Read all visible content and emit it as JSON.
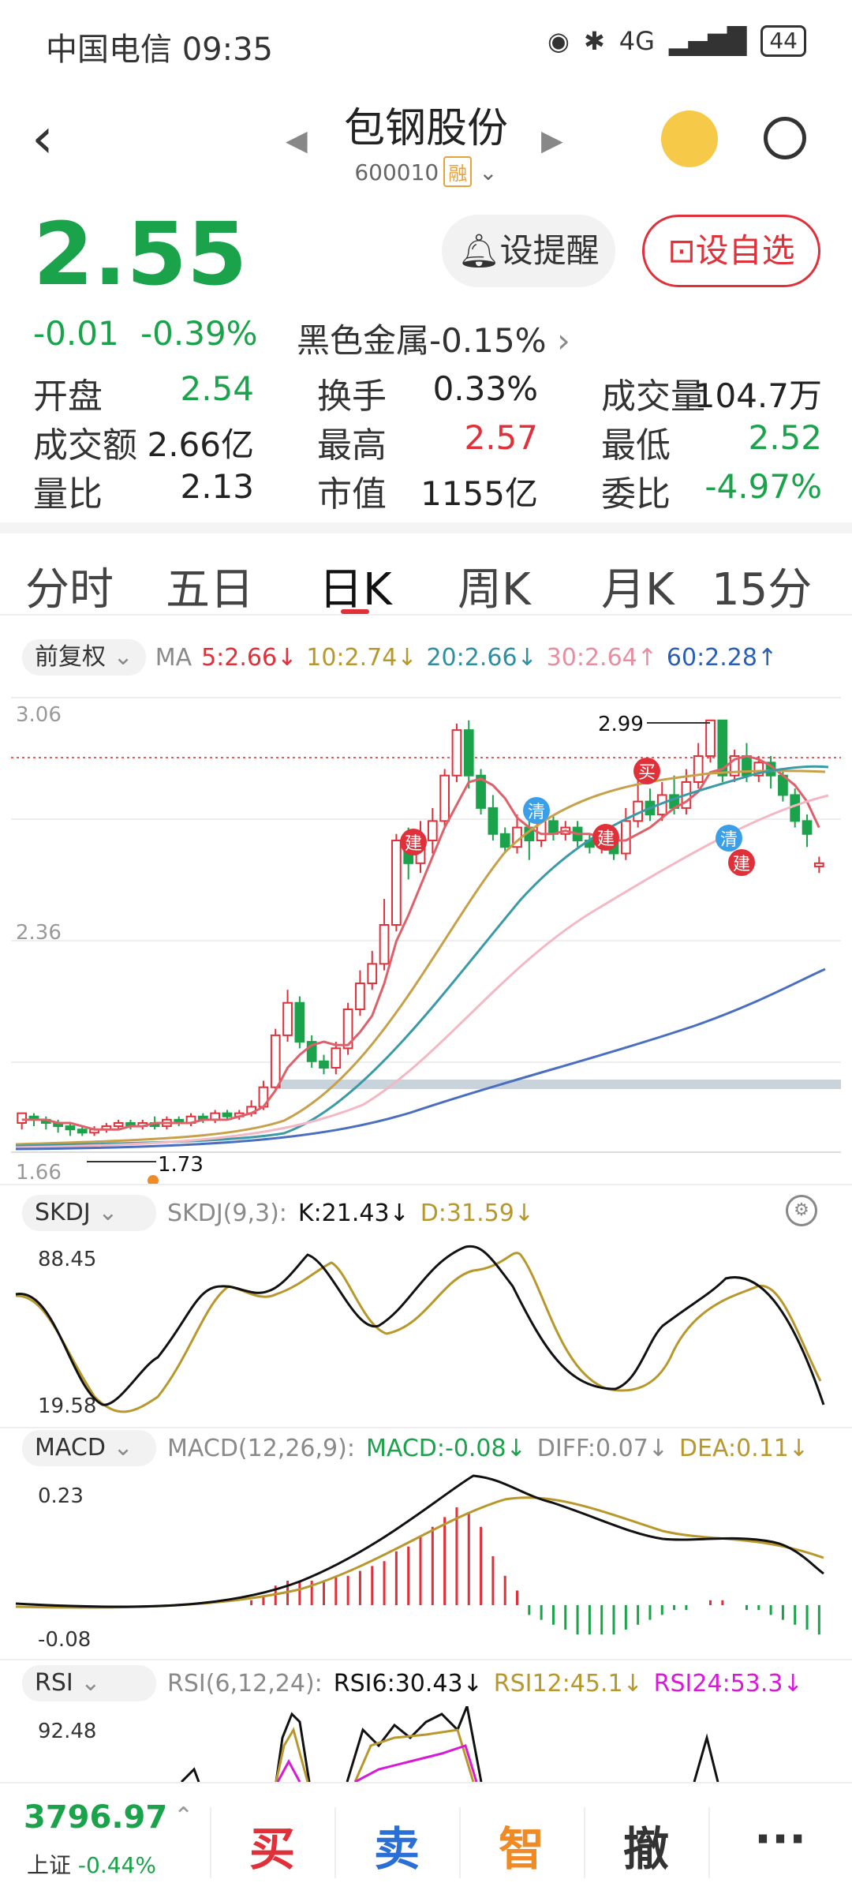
{
  "status": {
    "carrier": "中国电信 09:35",
    "battery": "44",
    "net": "4G"
  },
  "header": {
    "name": "包钢股份",
    "code": "600010",
    "rong": "融"
  },
  "quote": {
    "price": "2.55",
    "change": "-0.01",
    "pct": "-0.39%",
    "sector": "黑色金属",
    "sector_pct": "-0.15%",
    "remind_label": "设提醒",
    "add_label": "设自选"
  },
  "stats": [
    {
      "label": "开盘",
      "value": "2.54",
      "color": "#1aa34a"
    },
    {
      "label": "换手",
      "value": "0.33%",
      "color": "#222"
    },
    {
      "label": "成交量",
      "value": "104.7万",
      "color": "#222"
    },
    {
      "label": "成交额",
      "value": "2.66亿",
      "color": "#222"
    },
    {
      "label": "最高",
      "value": "2.57",
      "color": "#e0303a"
    },
    {
      "label": "最低",
      "value": "2.52",
      "color": "#1aa34a"
    },
    {
      "label": "量比",
      "value": "2.13",
      "color": "#222"
    },
    {
      "label": "市值",
      "value": "1155亿",
      "color": "#222"
    },
    {
      "label": "委比",
      "value": "-4.97%",
      "color": "#1aa34a"
    }
  ],
  "tabs": [
    "分时",
    "五日",
    "日K",
    "周K",
    "月K",
    "15分"
  ],
  "ma": {
    "mode": "前复权",
    "label": "MA",
    "ma5": "5:2.66↓",
    "ma10": "10:2.74↓",
    "ma20": "20:2.66↓",
    "ma30": "30:2.64↑",
    "ma60": "60:2.28↑"
  },
  "kline": {
    "ymax": "3.06",
    "ymid": "2.36",
    "ymin": "1.66",
    "hi_label": "2.99",
    "lo_label": "1.73",
    "markers": [
      "建",
      "清",
      "建",
      "买",
      "清",
      "建"
    ]
  },
  "skdj": {
    "name": "SKDJ",
    "params": "SKDJ(9,3):",
    "k": "K:21.43↓",
    "d": "D:31.59↓",
    "ymax": "88.45",
    "ymin": "19.58"
  },
  "macd": {
    "name": "MACD",
    "params": "MACD(12,26,9):",
    "macd": "MACD:-0.08↓",
    "diff": "DIFF:0.07↓",
    "dea": "DEA:0.11↓",
    "ymax": "0.23",
    "ymin": "-0.08"
  },
  "rsi": {
    "name": "RSI",
    "params": "RSI(6,12,24):",
    "r6": "RSI6:30.43↓",
    "r12": "RSI12:45.1↓",
    "r24": "RSI24:53.3↓",
    "ymax": "92.48"
  },
  "bottom": {
    "index_value": "3796.97",
    "index_name": "上证",
    "index_pct": "-0.44%",
    "buy": "买",
    "sell": "卖",
    "smart": "智",
    "cancel": "撤",
    "more": "···"
  },
  "chart_data": {
    "type": "candlestick",
    "title": "",
    "ylim": [
      1.66,
      3.06
    ],
    "candles": [
      [
        1.75,
        1.78,
        1.73,
        1.77
      ],
      [
        1.77,
        1.76,
        1.74,
        1.78
      ],
      [
        1.76,
        1.75,
        1.73,
        1.77
      ],
      [
        1.75,
        1.74,
        1.72,
        1.76
      ],
      [
        1.74,
        1.73,
        1.71,
        1.75
      ],
      [
        1.73,
        1.72,
        1.71,
        1.74
      ],
      [
        1.72,
        1.73,
        1.71,
        1.74
      ],
      [
        1.73,
        1.74,
        1.72,
        1.75
      ],
      [
        1.74,
        1.75,
        1.73,
        1.76
      ],
      [
        1.75,
        1.74,
        1.73,
        1.76
      ],
      [
        1.74,
        1.75,
        1.73,
        1.76
      ],
      [
        1.75,
        1.74,
        1.73,
        1.77
      ],
      [
        1.74,
        1.76,
        1.73,
        1.77
      ],
      [
        1.76,
        1.75,
        1.74,
        1.77
      ],
      [
        1.75,
        1.77,
        1.74,
        1.78
      ],
      [
        1.77,
        1.76,
        1.75,
        1.78
      ],
      [
        1.76,
        1.78,
        1.75,
        1.79
      ],
      [
        1.78,
        1.77,
        1.76,
        1.79
      ],
      [
        1.77,
        1.78,
        1.76,
        1.79
      ],
      [
        1.78,
        1.8,
        1.77,
        1.82
      ],
      [
        1.8,
        1.86,
        1.79,
        1.88
      ],
      [
        1.86,
        2.02,
        1.85,
        2.04
      ],
      [
        2.02,
        2.12,
        2.0,
        2.16
      ],
      [
        2.12,
        2.0,
        1.98,
        2.14
      ],
      [
        2.0,
        1.94,
        1.92,
        2.02
      ],
      [
        1.94,
        1.92,
        1.9,
        1.96
      ],
      [
        1.92,
        1.98,
        1.9,
        2.0
      ],
      [
        1.98,
        2.1,
        1.96,
        2.12
      ],
      [
        2.1,
        2.18,
        2.08,
        2.22
      ],
      [
        2.18,
        2.24,
        2.16,
        2.28
      ],
      [
        2.24,
        2.36,
        2.22,
        2.44
      ],
      [
        2.36,
        2.62,
        2.34,
        2.64
      ],
      [
        2.62,
        2.55,
        2.5,
        2.66
      ],
      [
        2.55,
        2.62,
        2.52,
        2.68
      ],
      [
        2.62,
        2.68,
        2.58,
        2.72
      ],
      [
        2.68,
        2.82,
        2.66,
        2.84
      ],
      [
        2.82,
        2.96,
        2.8,
        2.98
      ],
      [
        2.96,
        2.82,
        2.78,
        2.99
      ],
      [
        2.82,
        2.72,
        2.7,
        2.84
      ],
      [
        2.72,
        2.64,
        2.62,
        2.76
      ],
      [
        2.64,
        2.6,
        2.58,
        2.66
      ],
      [
        2.6,
        2.66,
        2.58,
        2.7
      ],
      [
        2.66,
        2.62,
        2.56,
        2.7
      ],
      [
        2.62,
        2.68,
        2.6,
        2.72
      ],
      [
        2.68,
        2.64,
        2.62,
        2.7
      ],
      [
        2.64,
        2.66,
        2.62,
        2.68
      ],
      [
        2.66,
        2.62,
        2.6,
        2.68
      ],
      [
        2.62,
        2.6,
        2.58,
        2.64
      ],
      [
        2.6,
        2.62,
        2.58,
        2.64
      ],
      [
        2.62,
        2.58,
        2.56,
        2.64
      ],
      [
        2.58,
        2.68,
        2.56,
        2.72
      ],
      [
        2.68,
        2.74,
        2.66,
        2.84
      ],
      [
        2.74,
        2.7,
        2.68,
        2.78
      ],
      [
        2.7,
        2.76,
        2.68,
        2.8
      ],
      [
        2.76,
        2.72,
        2.7,
        2.82
      ],
      [
        2.72,
        2.8,
        2.7,
        2.84
      ],
      [
        2.8,
        2.88,
        2.78,
        2.92
      ],
      [
        2.88,
        2.99,
        2.86,
        2.99
      ],
      [
        2.99,
        2.82,
        2.8,
        2.99
      ],
      [
        2.82,
        2.88,
        2.8,
        2.9
      ],
      [
        2.88,
        2.82,
        2.8,
        2.92
      ],
      [
        2.82,
        2.86,
        2.8,
        2.88
      ],
      [
        2.86,
        2.82,
        2.78,
        2.88
      ],
      [
        2.82,
        2.76,
        2.74,
        2.84
      ],
      [
        2.76,
        2.68,
        2.66,
        2.78
      ],
      [
        2.68,
        2.64,
        2.6,
        2.7
      ],
      [
        2.54,
        2.55,
        2.52,
        2.57
      ]
    ],
    "ma5": [
      1.76,
      1.76,
      1.76,
      1.75,
      1.75,
      1.74,
      1.73,
      1.73,
      1.73,
      1.74,
      1.74,
      1.75,
      1.75,
      1.75,
      1.75,
      1.76,
      1.76,
      1.76,
      1.77,
      1.78,
      1.8,
      1.85,
      1.92,
      1.96,
      1.99,
      2.0,
      1.99,
      1.99,
      2.03,
      2.08,
      2.18,
      2.31,
      2.39,
      2.48,
      2.57,
      2.66,
      2.73,
      2.8,
      2.81,
      2.79,
      2.75,
      2.69,
      2.66,
      2.64,
      2.64,
      2.65,
      2.64,
      2.64,
      2.63,
      2.62,
      2.62,
      2.64,
      2.66,
      2.69,
      2.72,
      2.74,
      2.77,
      2.83,
      2.84,
      2.87,
      2.88,
      2.87,
      2.85,
      2.82,
      2.79,
      2.74,
      2.66
    ]
  }
}
